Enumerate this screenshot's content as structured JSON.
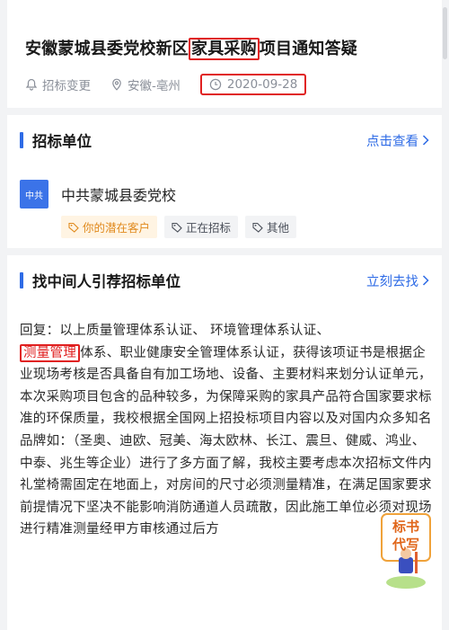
{
  "header": {
    "title_before": "安徽蒙城县委党校新区",
    "title_highlight": "家具采购",
    "title_after": "项目通知答疑",
    "category": "招标变更",
    "region": "安徽-亳州",
    "date": "2020-09-28"
  },
  "tender_section": {
    "title": "招标单位",
    "link": "点击查看",
    "org_logo_text": "中共",
    "org_name": "中共蒙城县委党校",
    "tags": [
      "你的潜在客户",
      "正在招标",
      "其他"
    ]
  },
  "agent_section": {
    "title": "找中间人引荐招标单位",
    "link": "立刻去找",
    "reply_line1": "回复：以上质量管理体系认证、 环境管理体系认证、",
    "reply_highlight": "测量管理",
    "reply_rest": "体系、职业健康安全管理体系认证，获得该项证书是根据企业现场考核是否具备自有加工场地、设备、主要材料来划分认证单元，本次采购项目包含的品种较多，为保障采购的家具产品符合国家要求标准的环保质量，我校根据全国网上招投标项目内容以及对国内众多知名品牌如：（圣奥、迪欧、冠美、海太欧林、长江、震旦、健威、鸿业、中泰、兆生等企业）进行了多方面了解，我校主要考虑本次招标文件内礼堂椅需固定在地面上，对房间的尺寸必须测量精准，在满足国家要求前提情况下坚决不能影响消防通道人员疏散，因此施工单位必须对现场进行精准测量经甲方审核通过后方"
  },
  "fab": {
    "line1": "标书",
    "line2": "代写"
  },
  "colors": {
    "accent": "#2e6be6",
    "highlight": "#e02020",
    "tag_orange": "#e08a1e"
  }
}
